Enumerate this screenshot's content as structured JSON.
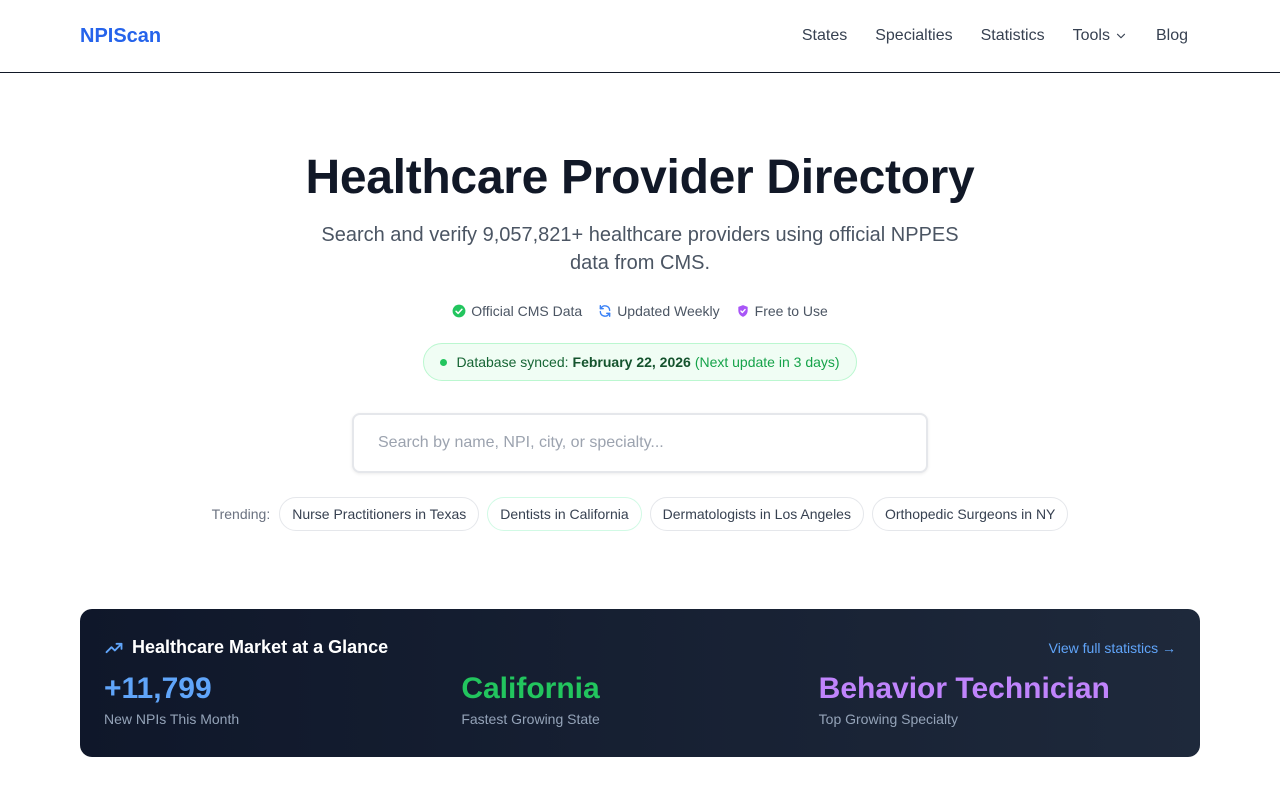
{
  "brand": "NPIScan",
  "nav": {
    "states": "States",
    "specialties": "Specialties",
    "statistics": "Statistics",
    "tools": "Tools",
    "blog": "Blog"
  },
  "hero": {
    "title": "Healthcare Provider Directory",
    "subtitle": "Search and verify 9,057,821+ healthcare providers using official NPPES data from CMS."
  },
  "features": {
    "official": "Official CMS Data",
    "updated": "Updated Weekly",
    "free": "Free to Use"
  },
  "sync": {
    "prefix": "Database synced:",
    "date": "February 22, 2026",
    "next": "(Next update in 3 days)"
  },
  "search": {
    "placeholder": "Search by name, NPI, city, or specialty..."
  },
  "trending": {
    "label": "Trending:",
    "chips": [
      "Nurse Practitioners in Texas",
      "Dentists in California",
      "Dermatologists in Los Angeles",
      "Orthopedic Surgeons in NY"
    ]
  },
  "market": {
    "title": "Healthcare Market at a Glance",
    "link": "View full statistics →",
    "stats": [
      {
        "value": "+11,799",
        "label": "New NPIs This Month",
        "color": "#60a5fa"
      },
      {
        "value": "California",
        "label": "Fastest Growing State",
        "color": "#22c55e"
      },
      {
        "value": "Behavior Technician",
        "label": "Top Growing Specialty",
        "color": "#c084fc"
      }
    ]
  },
  "colors": {
    "brand": "#2563eb",
    "sync_bg": "#f0fdf4",
    "market_bg": "#0f172a"
  }
}
